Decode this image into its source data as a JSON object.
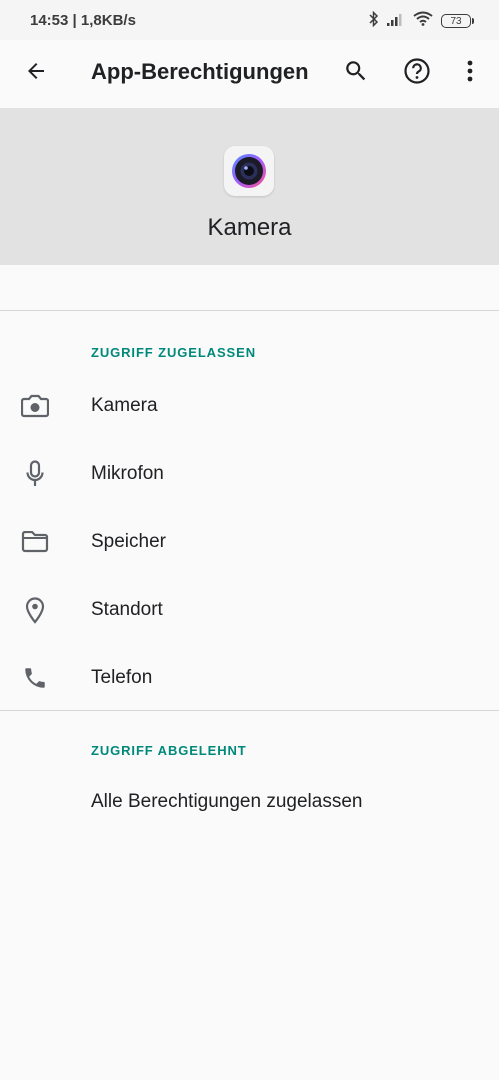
{
  "status": {
    "time": "14:53 | 1,8KB/s",
    "battery": "73",
    "icons": [
      "bluetooth-icon",
      "signal-icon",
      "wifi-icon",
      "battery-icon"
    ]
  },
  "appbar": {
    "title": "App-Berechtigungen",
    "icons": [
      "back-arrow-icon",
      "search-icon",
      "help-icon",
      "more-vert-icon"
    ]
  },
  "app": {
    "name": "Kamera"
  },
  "allowed": {
    "header": "ZUGRIFF ZUGELASSEN",
    "items": [
      {
        "label": "Kamera",
        "icon": "camera-icon"
      },
      {
        "label": "Mikrofon",
        "icon": "microphone-icon"
      },
      {
        "label": "Speicher",
        "icon": "folder-icon"
      },
      {
        "label": "Standort",
        "icon": "location-pin-icon"
      },
      {
        "label": "Telefon",
        "icon": "phone-icon"
      }
    ]
  },
  "denied": {
    "header": "ZUGRIFF ABGELEHNT",
    "message": "Alle Berechtigungen zugelassen"
  },
  "colors": {
    "accent": "#00897b",
    "header_bg": "#e2e2e2",
    "background": "#fafafa"
  }
}
